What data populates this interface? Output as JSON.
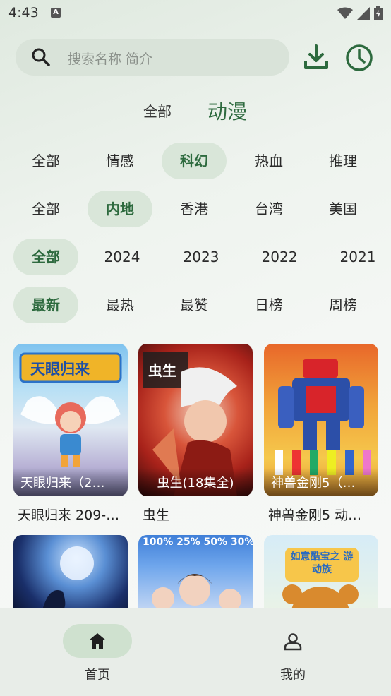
{
  "status_bar": {
    "time": "4:43",
    "notif_letter": "A"
  },
  "search": {
    "placeholder": "搜索名称 简介"
  },
  "category_tabs": [
    {
      "label": "全部"
    },
    {
      "label": "动漫"
    }
  ],
  "filters": {
    "genre": [
      {
        "label": "全部"
      },
      {
        "label": "情感"
      },
      {
        "label": "科幻",
        "selected": true
      },
      {
        "label": "热血"
      },
      {
        "label": "推理"
      }
    ],
    "region": [
      {
        "label": "全部"
      },
      {
        "label": "内地",
        "selected": true
      },
      {
        "label": "香港"
      },
      {
        "label": "台湾"
      },
      {
        "label": "美国"
      }
    ],
    "year": [
      {
        "label": "全部",
        "selected": true
      },
      {
        "label": "2024"
      },
      {
        "label": "2023"
      },
      {
        "label": "2022"
      },
      {
        "label": "2021"
      }
    ],
    "sort": [
      {
        "label": "最新",
        "selected": true
      },
      {
        "label": "最热"
      },
      {
        "label": "最赞"
      },
      {
        "label": "日榜"
      },
      {
        "label": "周榜"
      }
    ]
  },
  "cards": [
    {
      "caption": "天眼归来（2…",
      "title": "天眼归来 209-…",
      "poster_text": "天眼归来"
    },
    {
      "caption": "虫生(18集全)",
      "title": "虫生",
      "poster_text": "虫生"
    },
    {
      "caption": "神兽金刚5（…",
      "title": "神兽金刚5 动…",
      "poster_text": ""
    }
  ],
  "cards_row2": [
    {
      "poster_text": ""
    },
    {
      "poster_text": "100% 25% 50% 30%"
    },
    {
      "poster_text": "如意酷宝之 游动族"
    }
  ],
  "bottom_nav": [
    {
      "label": "首页",
      "icon": "home-icon"
    },
    {
      "label": "我的",
      "icon": "person-icon"
    }
  ],
  "colors": {
    "accent": "#2d6a3e",
    "chip_bg": "#d9e6d9",
    "search_bg": "#d9e3d9"
  }
}
